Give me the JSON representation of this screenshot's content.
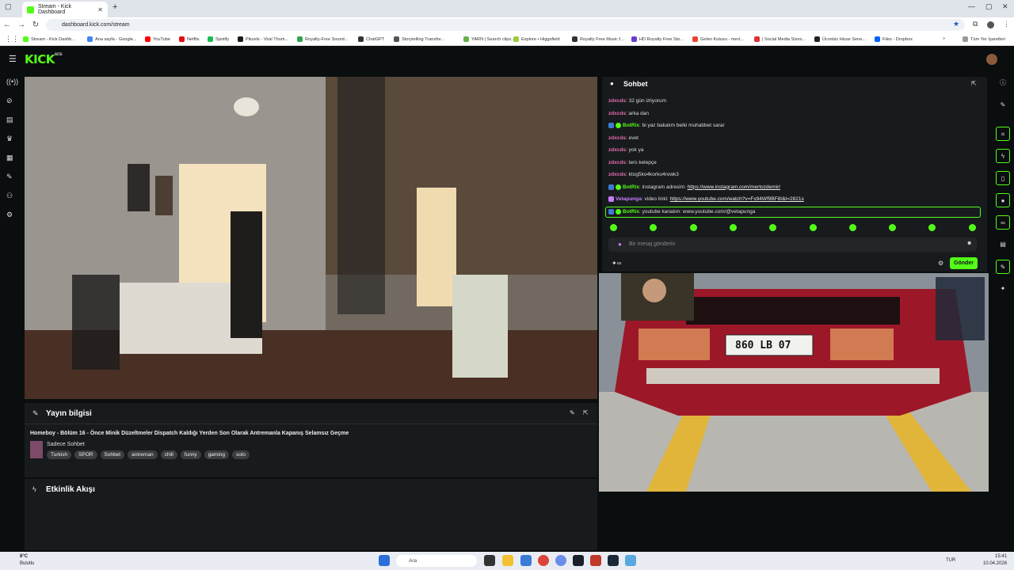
{
  "browser": {
    "tab_title": "Stream - Kick Dashboard",
    "url": "dashboard.kick.com/stream",
    "bookmarks": [
      "Stream - Kick Dashb...",
      "Ana sayfa - Google...",
      "YouTube",
      "Netflix",
      "Spotify",
      "Pikzels - Viral Thum...",
      "Royalty-Free Sound...",
      "ChatGPT",
      "Storytelling Transfor...",
      "YARN | Search clips...",
      "Explore • Higgsfield",
      "Royalty Free Music f...",
      "HD Royalty Free Sto...",
      "Gelen Kutusu - mert...",
      "| Social Media Sizes...",
      "Ücretsiz Hisse Sene...",
      "Files - Dropbox"
    ],
    "all_bookmarks": "Tüm Yer İşaretleri"
  },
  "app": {
    "logo": "KICK",
    "logo_sup": "BETA"
  },
  "info_panel": {
    "title": "Yayın bilgisi",
    "stream_title": "Homeboy - Bölüm 16 - Önce Minik Düzeltmeler Dispatch Kaldığı Yerden Son Olarak Antremanla Kapanış Selamsız Geçme",
    "category": "Sadece Sohbet",
    "tags": [
      "Turkish",
      "SPOR",
      "Sohbet",
      "antreman",
      "chill",
      "funny",
      "gaming",
      "solo"
    ]
  },
  "activity_panel": {
    "title": "Etkinlik Akışı"
  },
  "chat": {
    "title": "Sohbet",
    "placeholder": "Bir mesaj gönderin",
    "send": "Gönder",
    "messages": [
      {
        "user": "zdxcds",
        "text": "32 gün izliyorum"
      },
      {
        "user": "zdxcds",
        "text": "arka dan"
      },
      {
        "user": "BotRix",
        "text": "bi yaz bakalım belki muhabbet sarar"
      },
      {
        "user": "zdxcds",
        "text": "evet"
      },
      {
        "user": "zdxcds",
        "text": "yok ya"
      },
      {
        "user": "zdxcds",
        "text": "ters kelepçe"
      },
      {
        "user": "zdxcds",
        "text": "ktog5ko4korko4rowk3"
      },
      {
        "user": "BotRix",
        "text": "instagram adresim: ",
        "link": "https://www.instagram.com/mertozdemir/"
      },
      {
        "user": "Vetapunga",
        "text": "video linki: ",
        "link": "https://www.youtube.com/watch?v=Fx94Wf9BF8I&t=2821s"
      },
      {
        "user": "BotRix",
        "text": "youtube kanalım: www.youtube.com/@vetapunga"
      }
    ]
  },
  "game": {
    "plate": "860 LB 07"
  },
  "taskbar": {
    "weather_temp": "8°C",
    "weather_desc": "Bulutlu",
    "search": "Ara",
    "lang": "TUR",
    "time": "15:41",
    "date": "10.04.2026"
  }
}
